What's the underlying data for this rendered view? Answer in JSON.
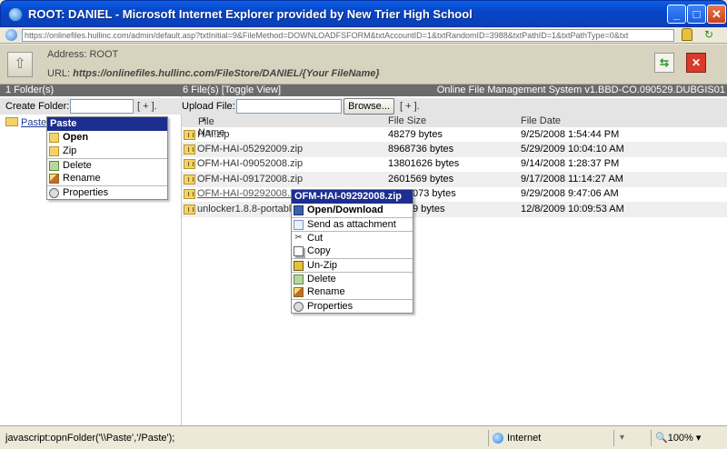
{
  "window": {
    "title": "ROOT: DANIEL - Microsoft Internet Explorer provided by New Trier High School",
    "minimize": "_",
    "maximize": "□",
    "close": "✕"
  },
  "address_bar": {
    "url": "https://onlinefiles.hullinc.com/admin/default.asp?txtInitial=9&FileMethod=DOWNLOADFSFORM&txtAccountID=1&txtRandomID=3988&txtPathID=1&txtPathType=0&txt"
  },
  "info_panel": {
    "address": "Address: ROOT",
    "url_prefix": "URL: ",
    "url_value": "https://onlinefiles.hullinc.com/FileStore/DANIEL/{Your FileName}",
    "go_glyph": "⇆",
    "close_glyph": "✕",
    "up_glyph": "⇧"
  },
  "left": {
    "header": "1 Folder(s)",
    "create_label": "Create Folder:",
    "create_value": "",
    "plus": "[ + ].",
    "folder_name": "Paste"
  },
  "right": {
    "header": "6 File(s) [Toggle View]",
    "system": "Online File Management System v1.BBD-CO.090529.DUBGIS01",
    "upload_label": "Upload File:",
    "upload_value": "",
    "browse": "Browse...",
    "plus": "[ + ].",
    "columns": {
      "name": "File Name",
      "size": "File Size",
      "date": "File Date",
      "sort_glyph": "▲"
    },
    "files": [
      {
        "name": "HAI.zip",
        "size": "48279 bytes",
        "date": "9/25/2008 1:54:44 PM"
      },
      {
        "name": "OFM-HAI-05292009.zip",
        "size": "8968736 bytes",
        "date": "5/29/2009 10:04:10 AM"
      },
      {
        "name": "OFM-HAI-09052008.zip",
        "size": "13801626 bytes",
        "date": "9/14/2008 1:28:37 PM"
      },
      {
        "name": "OFM-HAI-09172008.zip",
        "size": "2601569 bytes",
        "date": "9/17/2008 11:14:27 AM"
      },
      {
        "name": "OFM-HAI-09292008.zip",
        "size": "073 bytes",
        "date": "9/29/2008 9:47:06 AM"
      },
      {
        "name": "unlocker1.8.8-portable.z",
        "size": "9 bytes",
        "date": "12/8/2009 10:09:53 AM"
      }
    ]
  },
  "folder_menu": {
    "title": "Paste",
    "items": [
      "Open",
      "Zip",
      "Delete",
      "Rename",
      "Properties"
    ]
  },
  "file_menu": {
    "title": "OFM-HAI-09292008.zip",
    "items": [
      "Open/Download",
      "Send as attachment",
      "Cut",
      "Copy",
      "Un-Zip",
      "Delete",
      "Rename",
      "Properties"
    ],
    "cut_glyph": "✂"
  },
  "status": {
    "text": "javascript:opnFolder('\\\\Paste','/Paste');",
    "zone": "Internet",
    "protected": "▾",
    "zoom": "🔍100%  ▾"
  }
}
